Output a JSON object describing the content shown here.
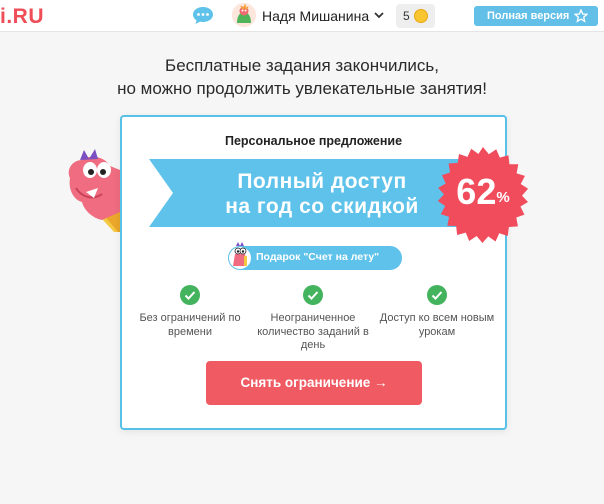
{
  "header": {
    "logo_text": "i.RU",
    "user_name": "Надя Мишанина",
    "coins_count": "5",
    "full_version_label": "Полная версия",
    "icons": [
      "chat-icon",
      "avatar",
      "chevron-down-icon",
      "coin-icon",
      "star-icon"
    ]
  },
  "headline": {
    "line1": "Бесплатные задания закончились,",
    "line2": "но можно продолжить увлекательные занятия!"
  },
  "offer": {
    "title": "Персональное предложение",
    "ribbon_line1": "Полный доступ",
    "ribbon_line2": "на год со скидкой",
    "discount_number": "62",
    "discount_unit": "%",
    "gift_label": "Подарок \"Счет на лету\"",
    "features": [
      "Без ограничений по времени",
      "Неограниченное количество заданий в день",
      "Доступ ко всем новым урокам"
    ],
    "cta_label": "Снять ограничение →"
  },
  "colors": {
    "accent_blue": "#58c1e8",
    "accent_red": "#ef5a63",
    "badge_red": "#f04c5c",
    "check_green": "#44b35e",
    "logo_red": "#ef4d57"
  }
}
